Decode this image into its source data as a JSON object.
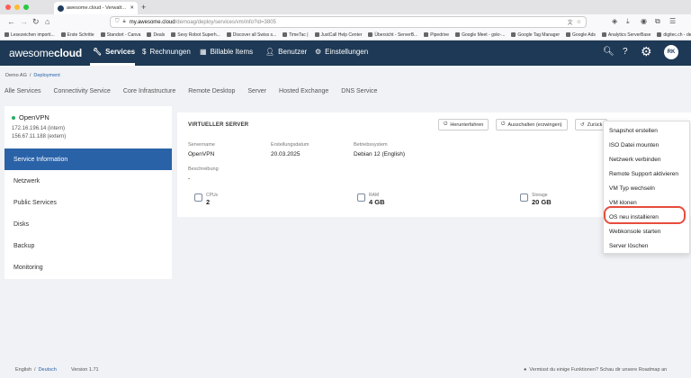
{
  "browser": {
    "tab_title": "awesome.cloud - Verwalte dein ...",
    "url_host": "my.awesome.cloud",
    "url_path": "/demoag/deploy/services/vm/info?id=3805",
    "colors": {
      "close": "#ff5f57",
      "minimize": "#febc2e",
      "maximize": "#28c840"
    },
    "bookmarks": [
      "Lesezeichen importi...",
      "Erste Schritte",
      "Standort - Canva",
      "Deals",
      "Sexy Robot Superh...",
      "Discover all Swiss s...",
      "TimeTac |",
      "JustCall Help Center",
      "Übersicht - ServerB...",
      "Pipedrive",
      "Google Meet - gxkr-...",
      "Google Tag Manager",
      "Google Ads",
      "Analytics ServerBase",
      "digitec.ch - der Onli..."
    ]
  },
  "header": {
    "logo_light": "awesome",
    "logo_bold": "cloud",
    "nav": {
      "services": "Services",
      "rechnungen": "Rechnungen",
      "billable": "Billable Items",
      "benutzer": "Benutzer",
      "einstellungen": "Einstellungen"
    },
    "avatar": "RK",
    "colors": {
      "bar": "#1e3955"
    }
  },
  "breadcrumb": {
    "org": "Demo AG",
    "sep": "/",
    "current": "Deployment"
  },
  "subnav": {
    "all": "Alle Services",
    "connectivity": "Connectivity Service",
    "core": "Core Infrastructure",
    "remote": "Remote Desktop",
    "server": "Server",
    "exchange": "Hosted Exchange",
    "dns": "DNS Service"
  },
  "left": {
    "service_name": "OpenVPN",
    "ip_internal": "172.16.196.14 (intern)",
    "ip_external": "156.67.11.188 (extern)",
    "menu": {
      "service_info": "Service Information",
      "netzwerk": "Netzwerk",
      "public": "Public Services",
      "disks": "Disks",
      "backup": "Backup",
      "monitoring": "Monitoring"
    },
    "colors": {
      "active": "#2a62a8",
      "status": "#27ae60"
    }
  },
  "card": {
    "title": "VIRTUELLER SERVER",
    "actions": {
      "shutdown": "Herunterfahren",
      "force_off": "Ausschalten (erzwingen)",
      "back": "Zurück"
    },
    "fields": {
      "servername_label": "Servername",
      "servername": "OpenVPN",
      "created_label": "Erstellungsdatum",
      "created": "20.03.2025",
      "os_label": "Betriebssystem",
      "os": "Debian 12 (English)",
      "desc_label": "Beschreibung",
      "desc": "-"
    },
    "metrics": {
      "cpus_label": "CPUs",
      "cpus": "2",
      "ram_label": "RAM",
      "ram": "4 GB",
      "storage_label": "Storage",
      "storage": "20 GB"
    }
  },
  "dropdown": {
    "items": [
      "Snapshot erstellen",
      "ISO Datei mounten",
      "Netzwerk verbinden",
      "Remote Support aktivieren",
      "VM Typ wechseln",
      "VM klonen",
      "OS neu installieren",
      "Webkonsole starten",
      "Server löschen"
    ],
    "highlight_color": "#e74c3c"
  },
  "footer": {
    "lang_en": "English",
    "lang_sep": "/",
    "lang_de": "Deutsch",
    "version": "Version 1.71",
    "feedback": "Vermisst du einige Funktionen? Schau dir unsere Roadmap an"
  }
}
